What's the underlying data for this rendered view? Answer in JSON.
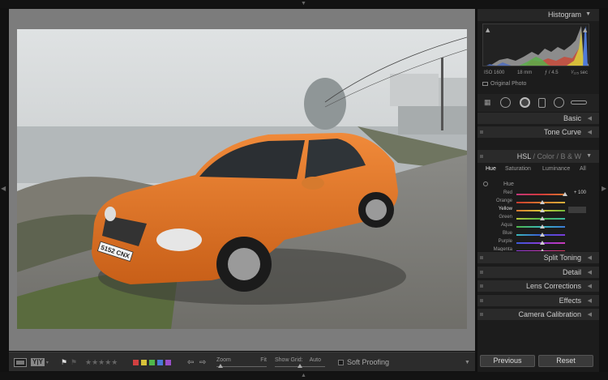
{
  "right_panel": {
    "histogram": {
      "title": "Histogram",
      "toggle": "▼",
      "iso": "ISO 1600",
      "focal_length": "18 mm",
      "aperture": "ƒ / 4.5",
      "shutter": "¹⁄₁₂₅ sec",
      "original_label": "Original Photo"
    },
    "sections": {
      "basic": "Basic",
      "tone_curve": "Tone Curve",
      "split_toning": "Split Toning",
      "detail": "Detail",
      "lens_corrections": "Lens Corrections",
      "effects": "Effects",
      "camera_calibration": "Camera Calibration"
    },
    "hsl": {
      "title_hsl": "HSL",
      "sep1": " / ",
      "title_color": "Color",
      "sep2": " / ",
      "title_bw": "B & W",
      "tabs": [
        "Hue",
        "Saturation",
        "Luminance",
        "All"
      ],
      "group_label": "Hue",
      "rows": [
        {
          "name": "Red",
          "value": "+ 100",
          "level": 1.0
        },
        {
          "name": "Orange",
          "value": "",
          "level": 0.5
        },
        {
          "name": "Yellow",
          "value": "",
          "level": 0.5
        },
        {
          "name": "Green",
          "value": "",
          "level": 0.5
        },
        {
          "name": "Aqua",
          "value": "",
          "level": 0.5
        },
        {
          "name": "Blue",
          "value": "",
          "level": 0.5
        },
        {
          "name": "Purple",
          "value": "",
          "level": 0.5
        },
        {
          "name": "Magenta",
          "value": "",
          "level": 0.5
        }
      ]
    },
    "buttons": {
      "previous": "Previous",
      "reset": "Reset"
    }
  },
  "toolbar": {
    "yy": "Y|Y",
    "zoom_label": "Zoom",
    "fit_label": "Fit",
    "grid_label": "Show Grid:",
    "grid_value": "Auto",
    "soft_proofing": "Soft Proofing",
    "label_colors": [
      "#d14040",
      "#d8c23a",
      "#4fb84a",
      "#4a79d6",
      "#9a4fc9"
    ]
  },
  "photo": {
    "plate": "5152 CNX"
  }
}
